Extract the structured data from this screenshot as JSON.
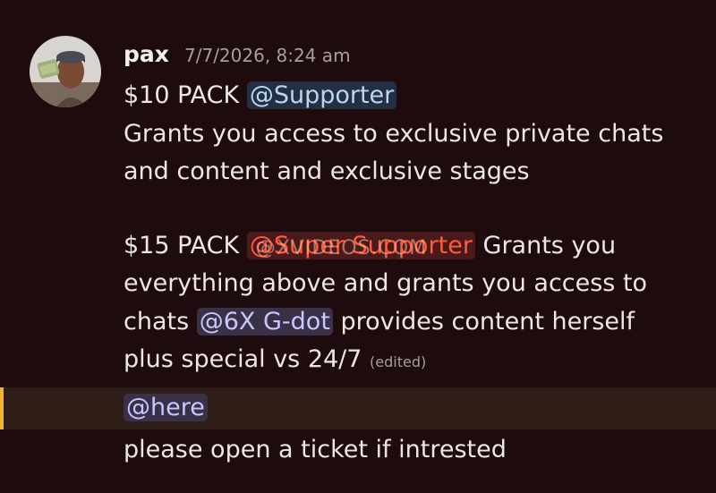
{
  "message": {
    "username": "pax",
    "timestamp": "7/7/2026, 8:24 am",
    "avatar_icon": "user-avatar-photo",
    "line1_prefix": "$10 PACK ",
    "mention_supporter": "@Supporter",
    "line2": "Grants you access to exclusive private chats",
    "line3": "and content and exclusive stages",
    "line4_prefix": "$15 PACK ",
    "mention_super_supporter": "@Super Supporter",
    "line4_suffix": " Grants you",
    "line5": "everything above and grants you access to",
    "line6_prefix": "chats ",
    "mention_gdot": "@6X G-dot",
    "line6_suffix": " provides content herself",
    "line7": "plus special vs 24/7 ",
    "edited_label": "(edited)",
    "mention_here": "@here",
    "line9": "please open a ticket if intrested"
  },
  "watermark": "@XVIDEOS.COM",
  "colors": {
    "background": "#1d0b0e",
    "highlight_row": "#2d1d16",
    "highlight_bar": "#f0b232",
    "mention_blue_text": "#b9d6f2",
    "mention_purple_text": "#c8c6ff",
    "mention_red_text": "#ff5a3a"
  }
}
